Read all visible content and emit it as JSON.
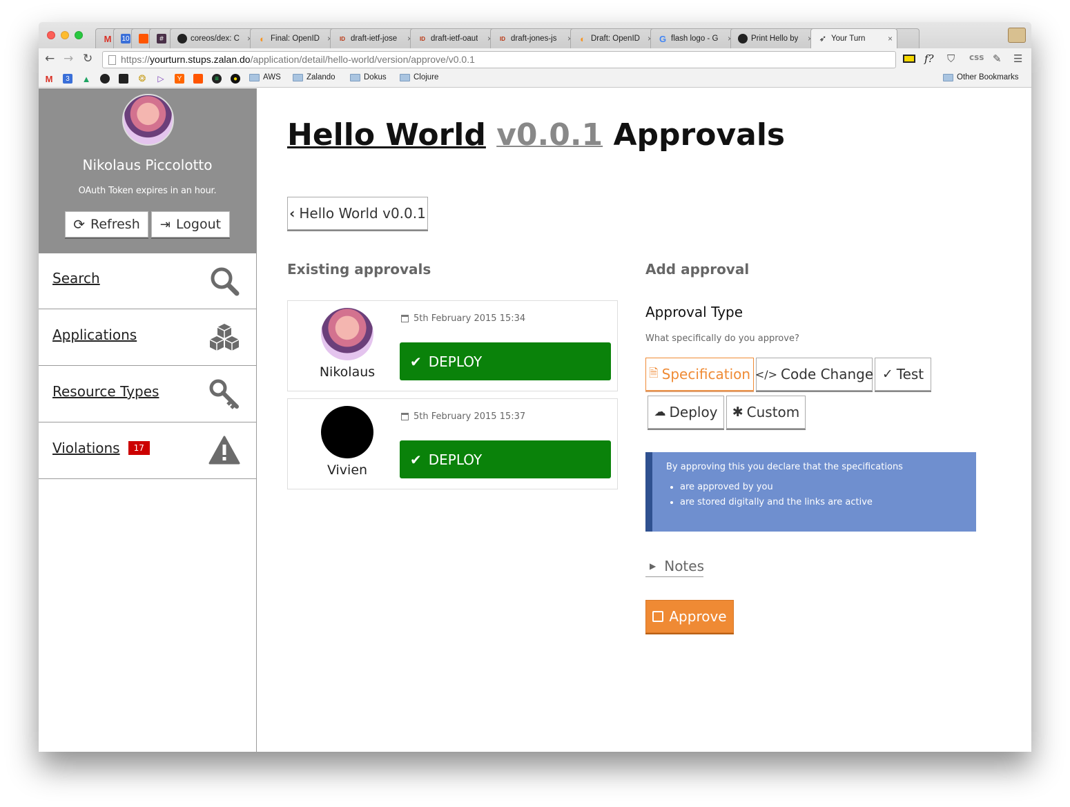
{
  "browser": {
    "tabs": [
      {
        "label": "",
        "icon": "gmail-icon"
      },
      {
        "label": "",
        "icon": "calendar-icon"
      },
      {
        "label": "",
        "icon": "soundcloud-icon"
      },
      {
        "label": "",
        "icon": "slack-icon"
      },
      {
        "label": "coreos/dex: C",
        "icon": "github-icon"
      },
      {
        "label": "Final: OpenID",
        "icon": "openid-icon"
      },
      {
        "label": "draft-ietf-jose",
        "icon": "ietf-icon"
      },
      {
        "label": "draft-ietf-oaut",
        "icon": "ietf-icon"
      },
      {
        "label": "draft-jones-js",
        "icon": "ietf-icon"
      },
      {
        "label": "Draft: OpenID",
        "icon": "openid-icon"
      },
      {
        "label": "flash logo - G",
        "icon": "google-icon"
      },
      {
        "label": "Print Hello by",
        "icon": "github-icon"
      },
      {
        "label": "Your Turn",
        "icon": "yourturn-icon"
      }
    ],
    "url_prefix": "https://",
    "url_host": "yourturn.stups.zalan.do",
    "url_path": "/application/detail/hello-world/version/approve/v0.0.1",
    "calendar_day": "10",
    "calendar_day_small": "3",
    "bookmark_folders": [
      "AWS",
      "Zalando",
      "Dokus",
      "Clojure"
    ],
    "other_bookmarks": "Other Bookmarks",
    "close_glyph": "×",
    "extension_f": "f?",
    "extension_css": "css"
  },
  "sidebar": {
    "user_name": "Nikolaus Piccolotto",
    "token_text": "OAuth Token expires in an hour.",
    "refresh_label": "Refresh",
    "logout_label": "Logout",
    "nav": [
      {
        "label": "Search",
        "icon": "search-icon"
      },
      {
        "label": "Applications",
        "icon": "cubes-icon"
      },
      {
        "label": "Resource Types",
        "icon": "key-icon"
      },
      {
        "label": "Violations",
        "icon": "warning-icon",
        "badge": "17"
      }
    ]
  },
  "main": {
    "title_app": "Hello World",
    "title_version": "v0.0.1",
    "title_suffix": "Approvals",
    "back_label": "Hello World v0.0.1",
    "existing_heading": "Existing approvals",
    "approvals": [
      {
        "user": "Nikolaus",
        "date": "5th February 2015 15:34",
        "type": "DEPLOY"
      },
      {
        "user": "Vivien",
        "date": "5th February 2015 15:37",
        "type": "DEPLOY"
      }
    ],
    "add_heading": "Add approval",
    "approval_type_title": "Approval Type",
    "approval_type_sub": "What specifically do you approve?",
    "types": [
      "Specification",
      "Code Change",
      "Test",
      "Deploy",
      "Custom"
    ],
    "selected_type": "Specification",
    "info_text": "By approving this you declare that the specifications",
    "info_items": [
      "are approved by you",
      "are stored digitally and the links are active"
    ],
    "notes_label": "Notes",
    "approve_label": "Approve"
  },
  "colors": {
    "deploy_green": "#0a820a",
    "accent_orange": "#ef8a34",
    "info_blue": "#6f8fcf",
    "badge_red": "#cc0000",
    "sidebar_gray": "#8f8f8f"
  }
}
